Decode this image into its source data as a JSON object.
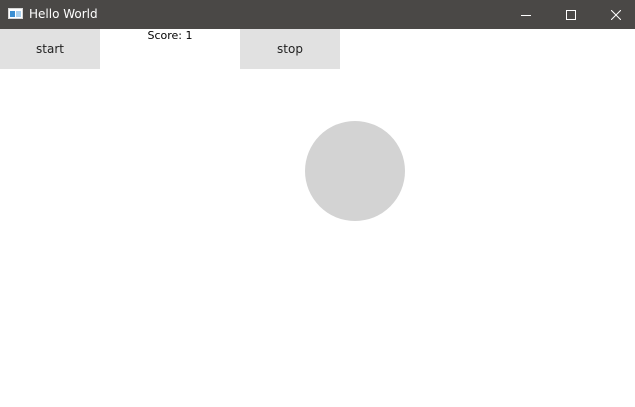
{
  "window": {
    "title": "Hello World",
    "icon": "window-app-icon",
    "titlebar_color": "#4a4846"
  },
  "controls": {
    "minimize_icon": "minimize-icon",
    "maximize_icon": "maximize-icon",
    "close_icon": "close-icon"
  },
  "toolbar": {
    "start_label": "start",
    "stop_label": "stop",
    "button_color": "#e1e1e1"
  },
  "score": {
    "label": "Score:",
    "value": "1"
  },
  "game": {
    "circle_color": "#d3d3d3"
  }
}
